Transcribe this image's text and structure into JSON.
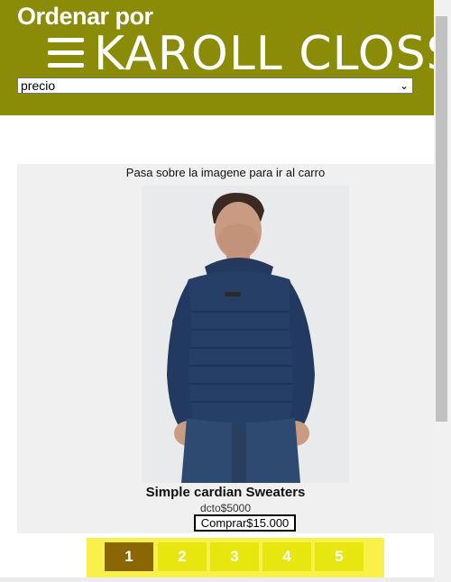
{
  "header": {
    "sort_title": "Ordenar por",
    "brand": "KAROLL CLOSS",
    "sort_select_value": "precio",
    "background": "#8a8b07"
  },
  "product": {
    "hint": "Pasa sobre la imagene para ir al carro",
    "name": "Simple cardian Sweaters",
    "discount": "dcto$5000",
    "buy_label": "Comprar$15.000"
  },
  "pagination": {
    "pages": [
      "1",
      "2",
      "3",
      "4",
      "5"
    ],
    "active": "1",
    "colors": {
      "bar": "#f9f14a",
      "button": "#e8e60f",
      "active": "#8a6700"
    }
  }
}
